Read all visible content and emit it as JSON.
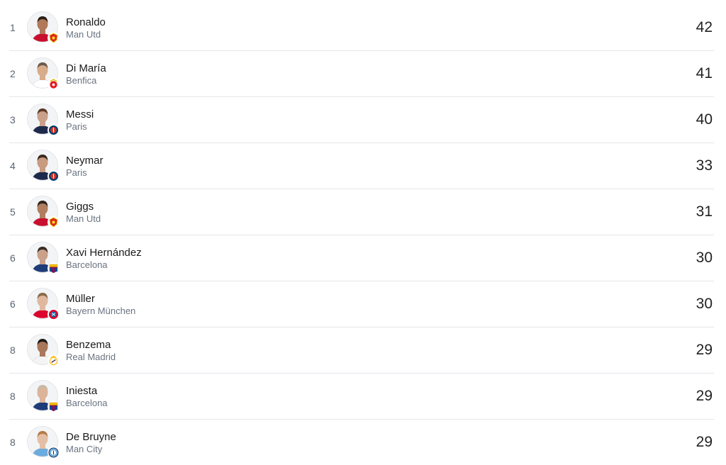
{
  "players": [
    {
      "rank": "1",
      "name": "Ronaldo",
      "team": "Man Utd",
      "value": "42",
      "badge": "man-utd-badge-icon",
      "skin": "#b07a5a",
      "hair": "#2b1f17",
      "shirt": "#c8102e"
    },
    {
      "rank": "2",
      "name": "Di María",
      "team": "Benfica",
      "value": "41",
      "badge": "benfica-badge-icon",
      "skin": "#d8ab8a",
      "hair": "#6b5a48",
      "shirt": "#ffffff"
    },
    {
      "rank": "3",
      "name": "Messi",
      "team": "Paris",
      "value": "40",
      "badge": "psg-badge-icon",
      "skin": "#caa08a",
      "hair": "#5a3b25",
      "shirt": "#1d2a4a"
    },
    {
      "rank": "4",
      "name": "Neymar",
      "team": "Paris",
      "value": "33",
      "badge": "psg-badge-icon",
      "skin": "#c89a80",
      "hair": "#3a2a1f",
      "shirt": "#1d2a4a"
    },
    {
      "rank": "5",
      "name": "Giggs",
      "team": "Man Utd",
      "value": "31",
      "badge": "man-utd-badge-icon",
      "skin": "#b07f5f",
      "hair": "#2d241c",
      "shirt": "#c8102e"
    },
    {
      "rank": "6",
      "name": "Xavi Hernández",
      "team": "Barcelona",
      "value": "30",
      "badge": "barcelona-badge-icon",
      "skin": "#caa18a",
      "hair": "#3a2c22",
      "shirt": "#1d3c78"
    },
    {
      "rank": "6",
      "name": "Müller",
      "team": "Bayern München",
      "value": "30",
      "badge": "bayern-badge-icon",
      "skin": "#e0b8a0",
      "hair": "#8a6a4a",
      "shirt": "#dc052d"
    },
    {
      "rank": "8",
      "name": "Benzema",
      "team": "Real Madrid",
      "value": "29",
      "badge": "real-madrid-badge-icon",
      "skin": "#a9785a",
      "hair": "#1f1a16",
      "shirt": "#f4f4f4"
    },
    {
      "rank": "8",
      "name": "Iniesta",
      "team": "Barcelona",
      "value": "29",
      "badge": "barcelona-badge-icon",
      "skin": "#dcb49a",
      "hair": "#c9b8a6",
      "shirt": "#1d3c78"
    },
    {
      "rank": "8",
      "name": "De Bruyne",
      "team": "Man City",
      "value": "29",
      "badge": "man-city-badge-icon",
      "skin": "#e3bfa5",
      "hair": "#b47b4a",
      "shirt": "#6cabdd"
    }
  ]
}
